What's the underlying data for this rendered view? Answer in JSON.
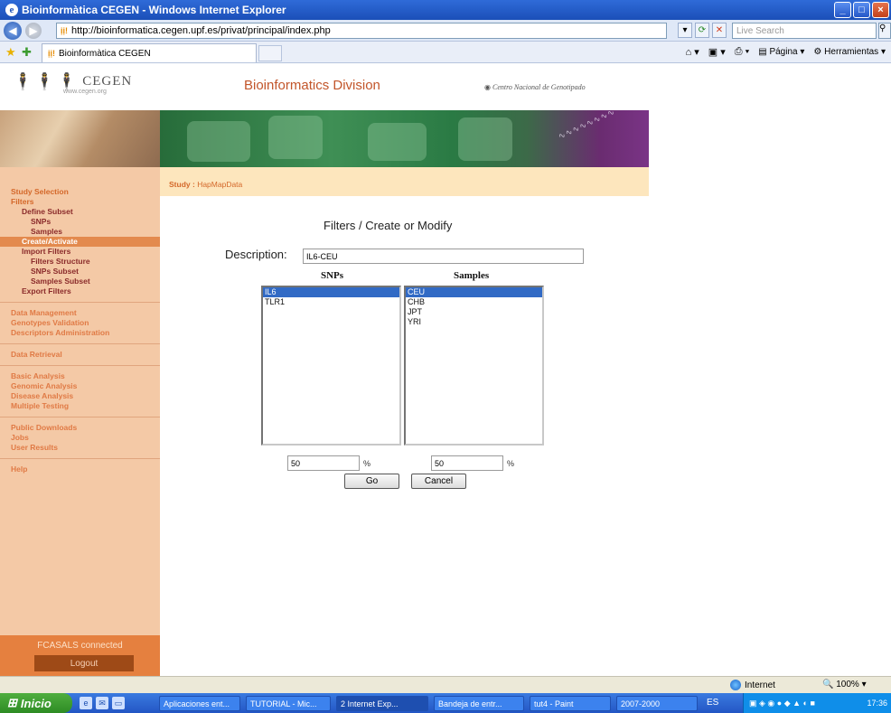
{
  "window": {
    "title": "Bioinformàtica CEGEN - Windows Internet Explorer"
  },
  "address": {
    "url": "http://bioinformatica.cegen.upf.es/privat/principal/index.php",
    "search_placeholder": "Live Search"
  },
  "tab": {
    "label": "Bioinformàtica CEGEN"
  },
  "commandbar": {
    "page": "Página",
    "tools": "Herramientas"
  },
  "header": {
    "brand": "CEGEN",
    "brand_url": "www.cegen.org",
    "division": "Bioinformatics Division",
    "cng": "Centro Nacional de Genotipado"
  },
  "sidebar": {
    "items": [
      {
        "label": "Study Selection"
      },
      {
        "label": "Filters"
      },
      {
        "label": "Define Subset"
      },
      {
        "label": "SNPs"
      },
      {
        "label": "Samples"
      },
      {
        "label": "Create/Activate"
      },
      {
        "label": "Import Filters"
      },
      {
        "label": "Filters Structure"
      },
      {
        "label": "SNPs Subset"
      },
      {
        "label": "Samples Subset"
      },
      {
        "label": "Export Filters"
      },
      {
        "label": "Data Management"
      },
      {
        "label": "Genotypes Validation"
      },
      {
        "label": "Descriptors Administration"
      },
      {
        "label": "Data Retrieval"
      },
      {
        "label": "Basic Analysis"
      },
      {
        "label": "Genomic Analysis"
      },
      {
        "label": "Disease Analysis"
      },
      {
        "label": "Multiple Testing"
      },
      {
        "label": "Public Downloads"
      },
      {
        "label": "Jobs"
      },
      {
        "label": "User Results"
      },
      {
        "label": "Help"
      }
    ],
    "connected": "FCASALS connected",
    "logout": "Logout"
  },
  "study": {
    "label": "Study :",
    "value": "HapMapData"
  },
  "form": {
    "title": "Filters / Create or Modify",
    "description_label": "Description:",
    "description_value": "IL6-CEU",
    "snps_header": "SNPs",
    "samples_header": "Samples",
    "snps": [
      "IL6",
      "TLR1"
    ],
    "samples": [
      "CEU",
      "CHB",
      "JPT",
      "YRI"
    ],
    "snps_pct": "50",
    "samples_pct": "50",
    "pct_symbol": "%",
    "go": "Go",
    "cancel": "Cancel"
  },
  "status": {
    "zone": "Internet",
    "zoom": "100%"
  },
  "taskbar": {
    "start": "Inicio",
    "items": [
      "Aplicaciones ent...",
      "TUTORIAL - Mic...",
      "2 Internet Exp...",
      "Bandeja de entr...",
      "tut4 - Paint",
      "2007-2000"
    ],
    "lang": "ES",
    "clock": "17:36"
  }
}
